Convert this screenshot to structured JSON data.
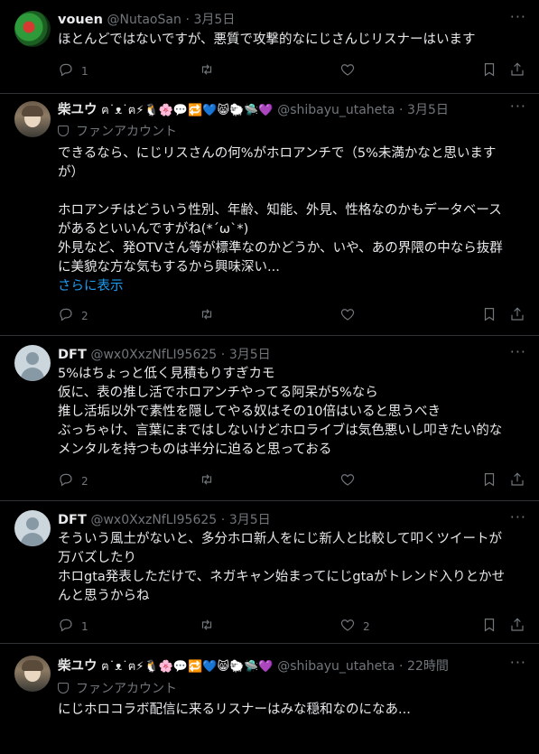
{
  "tweets": [
    {
      "name": "vouen",
      "handle": "@NutaoSan",
      "time": "3月5日",
      "emojis": "",
      "fan_label": "",
      "lines": [
        "ほとんどではないですが、悪質で攻撃的なにじさんじリスナーはいます"
      ],
      "show_more": "",
      "reply_count": "1",
      "retweet_count": "",
      "like_count": ""
    },
    {
      "name": "柴ユウ",
      "handle": "@shibayu_utaheta",
      "time": "3月5日",
      "emojis": "ฅ˙ᴥ˙ฅ⚡🐧🌸💬🔁💙😸🐑🛸💜",
      "fan_label": "ファンアカウント",
      "lines": [
        "できるなら、にじリスさんの何%がホロアンチで（5%未満かなと思います",
        "が）",
        "",
        "ホロアンチはどういう性別、年齢、知能、外見、性格なのかもデータベース",
        "があるといいんですがね(*´ω`*)",
        "外見など、発OTVさん等が標準なのかどうか、いや、あの界隈の中なら抜群",
        "に美貌な方な気もするから興味深い..."
      ],
      "show_more": "さらに表示",
      "reply_count": "2",
      "retweet_count": "",
      "like_count": ""
    },
    {
      "name": "DFT",
      "handle": "@wx0XxzNfLI95625",
      "time": "3月5日",
      "emojis": "",
      "fan_label": "",
      "lines": [
        "5%はちょっと低く見積もりすぎカモ",
        "仮に、表の推し活でホロアンチやってる阿呆が5%なら",
        "推し活垢以外で素性を隠してやる奴はその10倍はいると思うべき",
        "ぶっちゃけ、言葉にまではしないけどホロライブは気色悪いし叩きたい的な",
        "メンタルを持つものは半分に迫ると思っておる"
      ],
      "show_more": "",
      "reply_count": "2",
      "retweet_count": "",
      "like_count": ""
    },
    {
      "name": "DFT",
      "handle": "@wx0XxzNfLI95625",
      "time": "3月5日",
      "emojis": "",
      "fan_label": "",
      "lines": [
        "そういう風土がないと、多分ホロ新人をにじ新人と比較して叩くツイートが",
        "万バズしたり",
        "ホロgta発表しただけで、ネガキャン始まってにじgtaがトレンド入りとかせ",
        "んと思うからね"
      ],
      "show_more": "",
      "reply_count": "1",
      "retweet_count": "",
      "like_count": "2"
    },
    {
      "name": "柴ユウ",
      "handle": "@shibayu_utaheta",
      "time": "22時間",
      "emojis": "ฅ˙ᴥ˙ฅ⚡🐧🌸💬🔁💙😸🐑🛸💜",
      "fan_label": "ファンアカウント",
      "lines": [
        "にじホロコラボ配信に来るリスナーはみな穏和なのになあ..."
      ],
      "show_more": "",
      "reply_count": "",
      "retweet_count": "",
      "like_count": ""
    }
  ],
  "icons": {
    "more": "more-icon",
    "reply": "reply-icon",
    "retweet": "retweet-icon",
    "like": "like-icon",
    "bookmark": "bookmark-icon",
    "share": "share-icon",
    "fan": "fan-account-icon"
  },
  "colors": {
    "link": "#1d9bf0",
    "muted": "#71767b",
    "text": "#e7e9ea",
    "bg": "#000000"
  }
}
